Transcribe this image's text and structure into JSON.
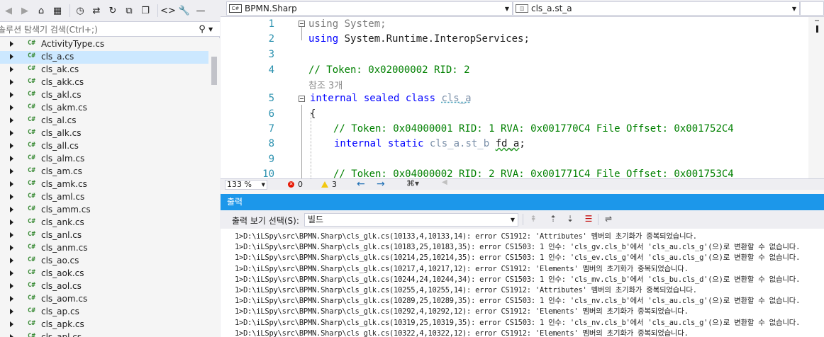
{
  "solution_explorer": {
    "search_placeholder": "솔루션 탐색기 검색(Ctrl+;)",
    "items": [
      {
        "label": "ActivityType.cs"
      },
      {
        "label": "cls_a.cs"
      },
      {
        "label": "cls_ak.cs"
      },
      {
        "label": "cls_akk.cs"
      },
      {
        "label": "cls_akl.cs"
      },
      {
        "label": "cls_akm.cs"
      },
      {
        "label": "cls_al.cs"
      },
      {
        "label": "cls_alk.cs"
      },
      {
        "label": "cls_all.cs"
      },
      {
        "label": "cls_alm.cs"
      },
      {
        "label": "cls_am.cs"
      },
      {
        "label": "cls_amk.cs"
      },
      {
        "label": "cls_aml.cs"
      },
      {
        "label": "cls_amm.cs"
      },
      {
        "label": "cls_ank.cs"
      },
      {
        "label": "cls_anl.cs"
      },
      {
        "label": "cls_anm.cs"
      },
      {
        "label": "cls_ao.cs"
      },
      {
        "label": "cls_aok.cs"
      },
      {
        "label": "cls_aol.cs"
      },
      {
        "label": "cls_aom.cs"
      },
      {
        "label": "cls_ap.cs"
      },
      {
        "label": "cls_apk.cs"
      },
      {
        "label": "cls_apl.cs"
      }
    ],
    "selected_index": 1,
    "file_icon_text": "C#"
  },
  "editor": {
    "project_combo": "BPMN.Sharp",
    "member_combo": "cls_a.st_a",
    "project_icon": "C#",
    "lines": {
      "l1": {
        "num": "1",
        "kw": "using",
        "rest": " System;"
      },
      "l2": {
        "num": "2",
        "kw": "using",
        "rest": " System.Runtime.InteropServices;"
      },
      "l3": {
        "num": "3"
      },
      "l4": {
        "num": "4",
        "comment": "// Token: 0x02000002 RID: 2"
      },
      "refs": "참조 3개",
      "l5": {
        "num": "5",
        "kw": "internal sealed class",
        "name": "cls_a"
      },
      "l6": {
        "num": "6",
        "text": "{"
      },
      "l7": {
        "num": "7",
        "comment": "// Token: 0x04000001 RID: 1 RVA: 0x001770C4 File Offset: 0x001752C4"
      },
      "l8": {
        "num": "8",
        "kw": "internal static",
        "type": "cls_a.st_b",
        "name": "fd_a",
        "end": ";"
      },
      "l9": {
        "num": "9"
      },
      "l10": {
        "num": "10",
        "comment": "// Token: 0x04000002 RID: 2 RVA: 0x001771C4 File Offset: 0x001753C4"
      }
    },
    "zoom": "133 %",
    "errors": "0",
    "warnings": "3"
  },
  "output": {
    "title": "출력",
    "show_from_label": "출력 보기 선택(S):",
    "show_from_value": "빌드",
    "lines": [
      "1>D:\\iLSpy\\src\\BPMN.Sharp\\cls_glk.cs(10133,4,10133,14): error CS1912: 'Attributes' 멤버의 초기화가 중복되었습니다.",
      "1>D:\\iLSpy\\src\\BPMN.Sharp\\cls_glk.cs(10183,25,10183,35): error CS1503: 1 인수: 'cls_gv.cls_b'에서 'cls_au.cls_g'(으)로 변환할 수 없습니다.",
      "1>D:\\iLSpy\\src\\BPMN.Sharp\\cls_glk.cs(10214,25,10214,35): error CS1503: 1 인수: 'cls_ev.cls_g'에서 'cls_au.cls_g'(으)로 변환할 수 없습니다.",
      "1>D:\\iLSpy\\src\\BPMN.Sharp\\cls_glk.cs(10217,4,10217,12): error CS1912: 'Elements' 멤버의 초기화가 중복되었습니다.",
      "1>D:\\iLSpy\\src\\BPMN.Sharp\\cls_glk.cs(10244,24,10244,34): error CS1503: 1 인수: 'cls_mv.cls_b'에서 'cls_bu.cls_d'(으)로 변환할 수 없습니다.",
      "1>D:\\iLSpy\\src\\BPMN.Sharp\\cls_glk.cs(10255,4,10255,14): error CS1912: 'Attributes' 멤버의 초기화가 중복되었습니다.",
      "1>D:\\iLSpy\\src\\BPMN.Sharp\\cls_glk.cs(10289,25,10289,35): error CS1503: 1 인수: 'cls_nv.cls_b'에서 'cls_au.cls_g'(으)로 변환할 수 없습니다.",
      "1>D:\\iLSpy\\src\\BPMN.Sharp\\cls_glk.cs(10292,4,10292,12): error CS1912: 'Elements' 멤버의 초기화가 중복되었습니다.",
      "1>D:\\iLSpy\\src\\BPMN.Sharp\\cls_glk.cs(10319,25,10319,35): error CS1503: 1 인수: 'cls_nv.cls_b'에서 'cls_au.cls_g'(으)로 변환할 수 없습니다.",
      "1>D:\\iLSpy\\src\\BPMN.Sharp\\cls_glk.cs(10322,4,10322,12): error CS1912: 'Elements' 멤버의 초기화가 중복되었습니다."
    ]
  },
  "colors": {
    "accent": "#1C97EA",
    "selection": "#CCE8FF",
    "keyword": "#0000FF",
    "comment": "#008000",
    "line_number": "#2B91AF",
    "cs_icon": "#388A34"
  }
}
